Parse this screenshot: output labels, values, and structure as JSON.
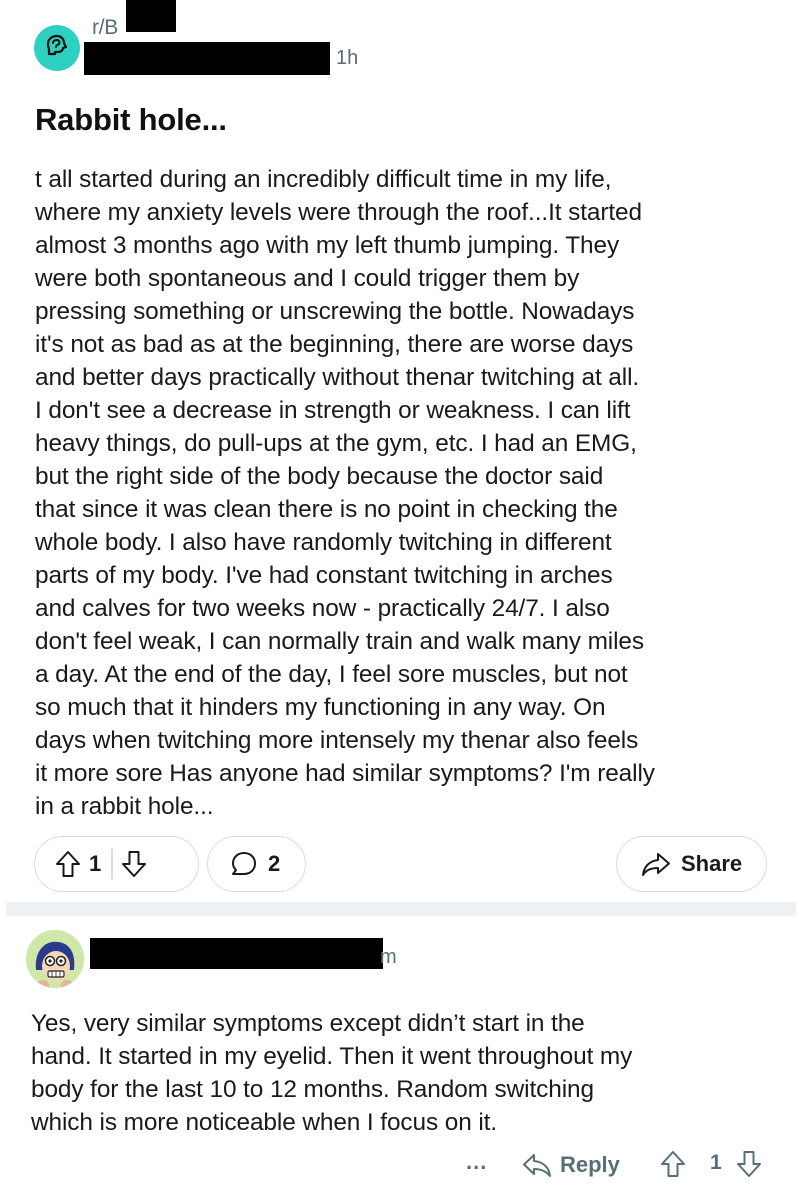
{
  "post": {
    "subreddit": "r/B",
    "time": "1h",
    "title": "Rabbit hole...",
    "body": "t all started during an incredibly difficult time in my life,\nwhere my anxiety levels were through the roof...It started\nalmost 3 months ago with my left thumb jumping. They\nwere both spontaneous and I could trigger them by\npressing something or unscrewing the bottle. Nowadays\nit's not as bad as at the beginning, there are worse days\nand better days practically without thenar twitching at all.\nI don't see a decrease in strength or weakness. I can lift\nheavy things, do pull-ups at the gym, etc. I had an EMG,\nbut the right side of the body because the doctor said\nthat since it was clean there is no point in checking the\nwhole body.  I also have randomly twitching in different\nparts of my body. I've had constant twitching in arches\nand calves for two weeks now - practically 24/7. I also\ndon't feel weak, I can normally train and walk many miles\na day.  At the end of the day, I feel sore muscles, but not\nso much that it hinders my functioning in any way. On\ndays when twitching more intensely my thenar also feels\nit more sore Has anyone had similar symptoms? I'm really\nin a rabbit hole...",
    "vote_count": "1",
    "comment_count": "2",
    "share_label": "Share",
    "accent_color": "#2ed1c1"
  },
  "comment": {
    "time_suffix": "m",
    "body": "Yes, very similar symptoms except didn’t start in the\nhand. It started in my eyelid. Then it went throughout my\nbody for the last 10 to 12 months. Random switching\nwhich is more noticeable when I focus on it.",
    "more_label": "...",
    "reply_label": "Reply",
    "vote_count": "1"
  },
  "icons": {
    "subreddit": "brain-icon",
    "upvote": "upvote-arrow-icon",
    "downvote": "downvote-arrow-icon",
    "comment": "comment-bubble-icon",
    "share": "share-arrow-icon",
    "reply": "reply-arrow-icon"
  }
}
